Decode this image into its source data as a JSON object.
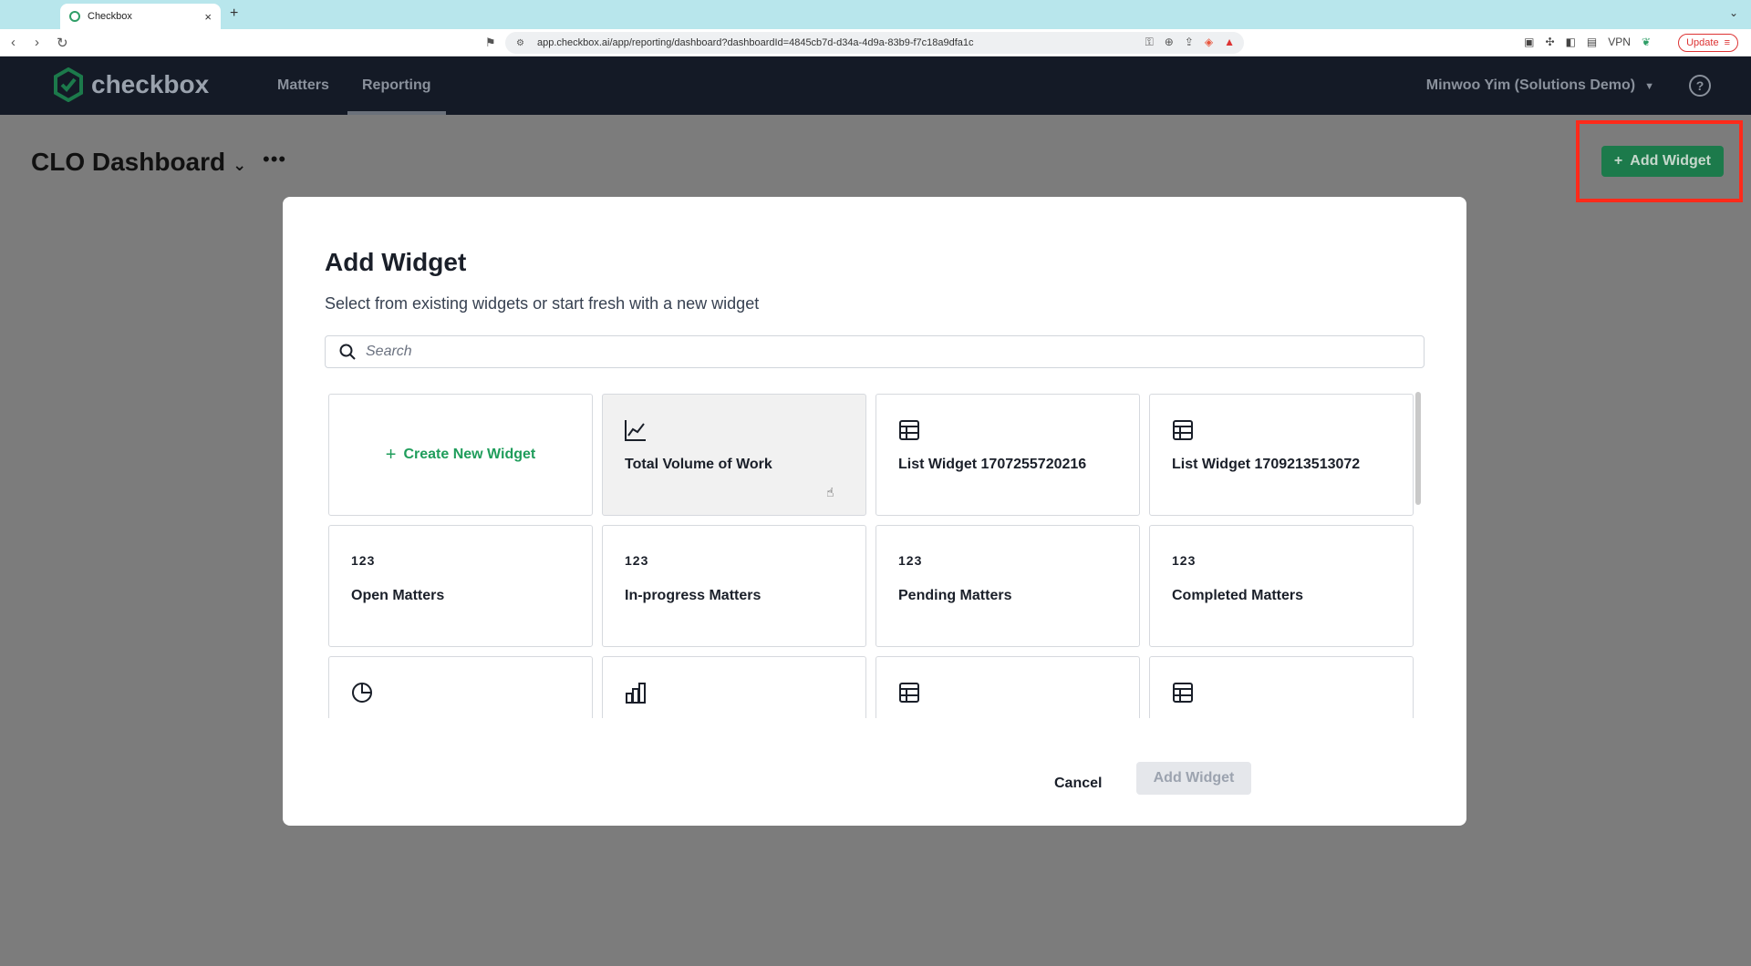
{
  "browser": {
    "tab_title": "Checkbox",
    "url": "app.checkbox.ai/app/reporting/dashboard?dashboardId=4845cb7d-d34a-4d9a-83b9-f7c18a9dfa1c",
    "vpn_label": "VPN",
    "update_label": "Update"
  },
  "header": {
    "brand": "checkbox",
    "nav": [
      {
        "label": "Matters"
      },
      {
        "label": "Reporting"
      }
    ],
    "user": "Minwoo Yim (Solutions Demo)",
    "help_glyph": "?",
    "brand_color": "#1f9d5b"
  },
  "page": {
    "title": "CLO Dashboard",
    "more_glyph": "•••",
    "add_widget_label": "Add Widget"
  },
  "modal": {
    "title": "Add Widget",
    "subtitle": "Select from existing widgets or start fresh with a new widget",
    "search_placeholder": "Search",
    "create_label": "Create New Widget",
    "cards": [
      {
        "icon": "line-chart-icon",
        "label": "Total Volume of Work"
      },
      {
        "icon": "table-icon",
        "label": "List Widget 1707255720216"
      },
      {
        "icon": "table-icon",
        "label": "List Widget 1709213513072"
      },
      {
        "icon": "number-icon",
        "num": "123",
        "label": "Open Matters"
      },
      {
        "icon": "number-icon",
        "num": "123",
        "label": "In-progress Matters"
      },
      {
        "icon": "number-icon",
        "num": "123",
        "label": "Pending Matters"
      },
      {
        "icon": "number-icon",
        "num": "123",
        "label": "Completed Matters"
      },
      {
        "icon": "pie-chart-icon",
        "label": ""
      },
      {
        "icon": "bar-chart-icon",
        "label": ""
      },
      {
        "icon": "table-icon",
        "label": ""
      },
      {
        "icon": "table-icon",
        "label": ""
      }
    ],
    "cancel_label": "Cancel",
    "add_label": "Add Widget"
  }
}
